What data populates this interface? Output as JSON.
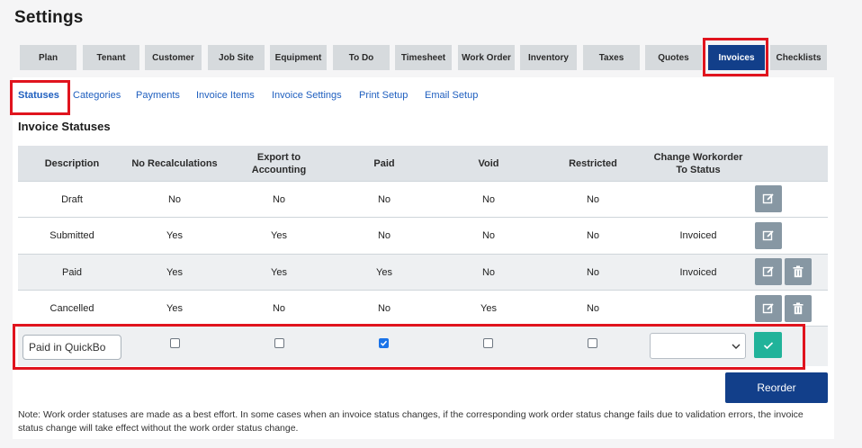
{
  "page_title": "Settings",
  "colors": {
    "accent": "#123f8a",
    "highlight": "#e0141e",
    "save": "#21b39a",
    "link": "#1f5fbf"
  },
  "top_tabs": [
    "Plan",
    "Tenant",
    "Customer",
    "Job Site",
    "Equipment",
    "To Do",
    "Timesheet",
    "Work Order",
    "Inventory",
    "Taxes",
    "Quotes",
    "Invoices",
    "Checklists"
  ],
  "active_top_tab": "Invoices",
  "sub_tabs": [
    "Statuses",
    "Categories",
    "Payments",
    "Invoice Items",
    "Invoice Settings",
    "Print Setup",
    "Email Setup"
  ],
  "active_sub_tab": "Statuses",
  "section_title": "Invoice Statuses",
  "table": {
    "headers": [
      "Description",
      "No Recalculations",
      "Export to Accounting",
      "Paid",
      "Void",
      "Restricted",
      "Change Workorder To Status"
    ],
    "rows": [
      {
        "desc": "Draft",
        "norecalc": "No",
        "export": "No",
        "paid": "No",
        "void": "No",
        "restricted": "No",
        "change": "",
        "actions": [
          "edit-icon"
        ]
      },
      {
        "desc": "Submitted",
        "norecalc": "Yes",
        "export": "Yes",
        "paid": "No",
        "void": "No",
        "restricted": "No",
        "change": "Invoiced",
        "actions": [
          "edit-icon"
        ]
      },
      {
        "desc": "Paid",
        "norecalc": "Yes",
        "export": "Yes",
        "paid": "Yes",
        "void": "No",
        "restricted": "No",
        "change": "Invoiced",
        "actions": [
          "edit-icon",
          "trash-icon"
        ]
      },
      {
        "desc": "Cancelled",
        "norecalc": "Yes",
        "export": "No",
        "paid": "No",
        "void": "Yes",
        "restricted": "No",
        "change": "",
        "actions": [
          "edit-icon",
          "trash-icon"
        ]
      }
    ]
  },
  "new_row": {
    "description_value": "Paid in QuickBo",
    "no_recalculations": false,
    "export_to_accounting": false,
    "paid": true,
    "void": false,
    "restricted": false,
    "change_status_value": ""
  },
  "reorder_label": "Reorder",
  "note": "Note: Work order statuses are made as a best effort. In some cases when an invoice status changes, if the corresponding work order status change fails due to validation errors, the invoice status change will take effect without the work order status change."
}
